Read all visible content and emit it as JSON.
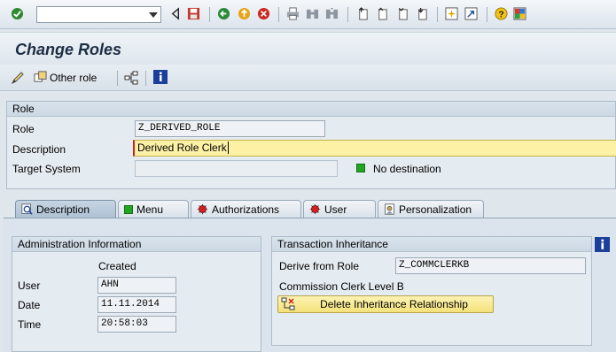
{
  "system_toolbar": {
    "command_field_value": "",
    "icons": [
      "enter-icon",
      "dropdown-icon",
      "back-icon",
      "save-icon",
      "back-green-icon",
      "exit-icon",
      "cancel-icon",
      "print-icon",
      "find-icon",
      "find-next-icon",
      "first-page-icon",
      "previous-page-icon",
      "next-page-icon",
      "last-page-icon",
      "new-session-icon",
      "shortcut-icon",
      "help-icon",
      "layout-icon"
    ]
  },
  "title": {
    "text": "Change Roles"
  },
  "app_toolbar": {
    "other_role_label": "Other role"
  },
  "role_group": {
    "heading": "Role",
    "role_label": "Role",
    "role_value": "Z_DERIVED_ROLE",
    "description_label": "Description",
    "description_value": "Derived Role Clerk",
    "target_system_label": "Target System",
    "target_system_value": "",
    "destination_status": "No destination",
    "status_color": "#22a622"
  },
  "tabs": [
    {
      "label": "Description",
      "active": true
    },
    {
      "label": "Menu",
      "active": false
    },
    {
      "label": "Authorizations",
      "active": false
    },
    {
      "label": "User",
      "active": false
    },
    {
      "label": "Personalization",
      "active": false
    }
  ],
  "admin_info": {
    "heading": "Administration Information",
    "created_header": "Created",
    "user_label": "User",
    "user_value": "AHN",
    "date_label": "Date",
    "date_value": "11.11.2014",
    "time_label": "Time",
    "time_value": "20:58:03"
  },
  "transaction_inheritance": {
    "heading": "Transaction Inheritance",
    "derive_label": "Derive from Role",
    "derive_value": "Z_COMMCLERKB",
    "derive_description": "Commission Clerk Level B",
    "delete_button_label": "Delete Inheritance Relationship"
  },
  "colors": {
    "accent_yellow": "#fdf1a6",
    "status_green": "#22a622",
    "status_red": "#d22020"
  }
}
